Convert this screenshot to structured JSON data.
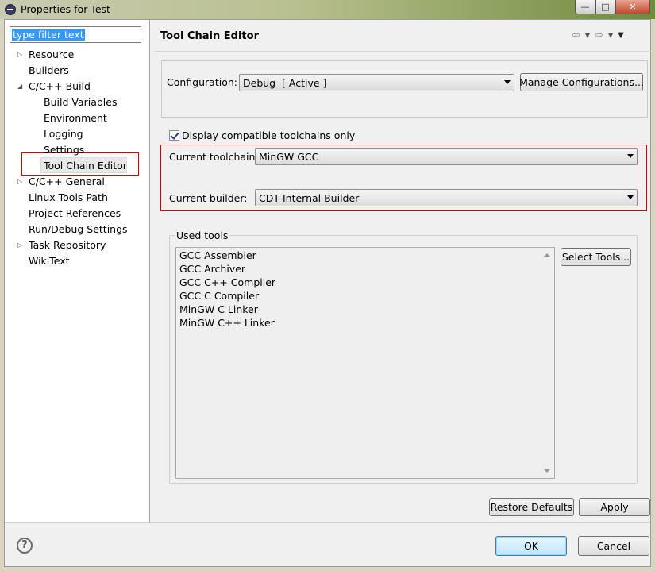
{
  "window": {
    "title": "Properties for Test"
  },
  "filter": {
    "value": "type filter text"
  },
  "tree": {
    "items": [
      {
        "label": "Resource",
        "expander": "collapsed"
      },
      {
        "label": "Builders",
        "expander": "none"
      },
      {
        "label": "C/C++ Build",
        "expander": "expanded"
      },
      {
        "label": "Build Variables",
        "expander": "none"
      },
      {
        "label": "Environment",
        "expander": "none"
      },
      {
        "label": "Logging",
        "expander": "none"
      },
      {
        "label": "Settings",
        "expander": "none"
      },
      {
        "label": "Tool Chain Editor",
        "expander": "none",
        "selected": true
      },
      {
        "label": "C/C++ General",
        "expander": "collapsed"
      },
      {
        "label": "Linux Tools Path",
        "expander": "none"
      },
      {
        "label": "Project References",
        "expander": "none"
      },
      {
        "label": "Run/Debug Settings",
        "expander": "none"
      },
      {
        "label": "Task Repository",
        "expander": "collapsed"
      },
      {
        "label": "WikiText",
        "expander": "none"
      }
    ]
  },
  "page": {
    "title": "Tool Chain Editor"
  },
  "config": {
    "label": "Configuration:",
    "value": "Debug  [ Active ]",
    "manage_button": "Manage Configurations..."
  },
  "toolchain": {
    "checkbox_label": "Display compatible toolchains only",
    "checked": true,
    "toolchain_label": "Current toolchain:",
    "toolchain_value": "MinGW GCC",
    "builder_label": "Current builder:",
    "builder_value": "CDT Internal Builder"
  },
  "used_tools": {
    "label": "Used tools",
    "items": [
      "GCC Assembler",
      "GCC Archiver",
      "GCC C++ Compiler",
      "GCC C Compiler",
      "MinGW C Linker",
      "MinGW C++ Linker"
    ],
    "select_button": "Select Tools..."
  },
  "buttons": {
    "restore_defaults": "Restore Defaults",
    "apply": "Apply",
    "ok": "OK",
    "cancel": "Cancel"
  },
  "icons": {
    "help": "?",
    "minimize": "—",
    "maximize": "□",
    "close": "✕",
    "back": "⇦",
    "forward": "⇨"
  },
  "colors": {
    "highlight_border": "#d40000",
    "selection": "#3399ff"
  }
}
